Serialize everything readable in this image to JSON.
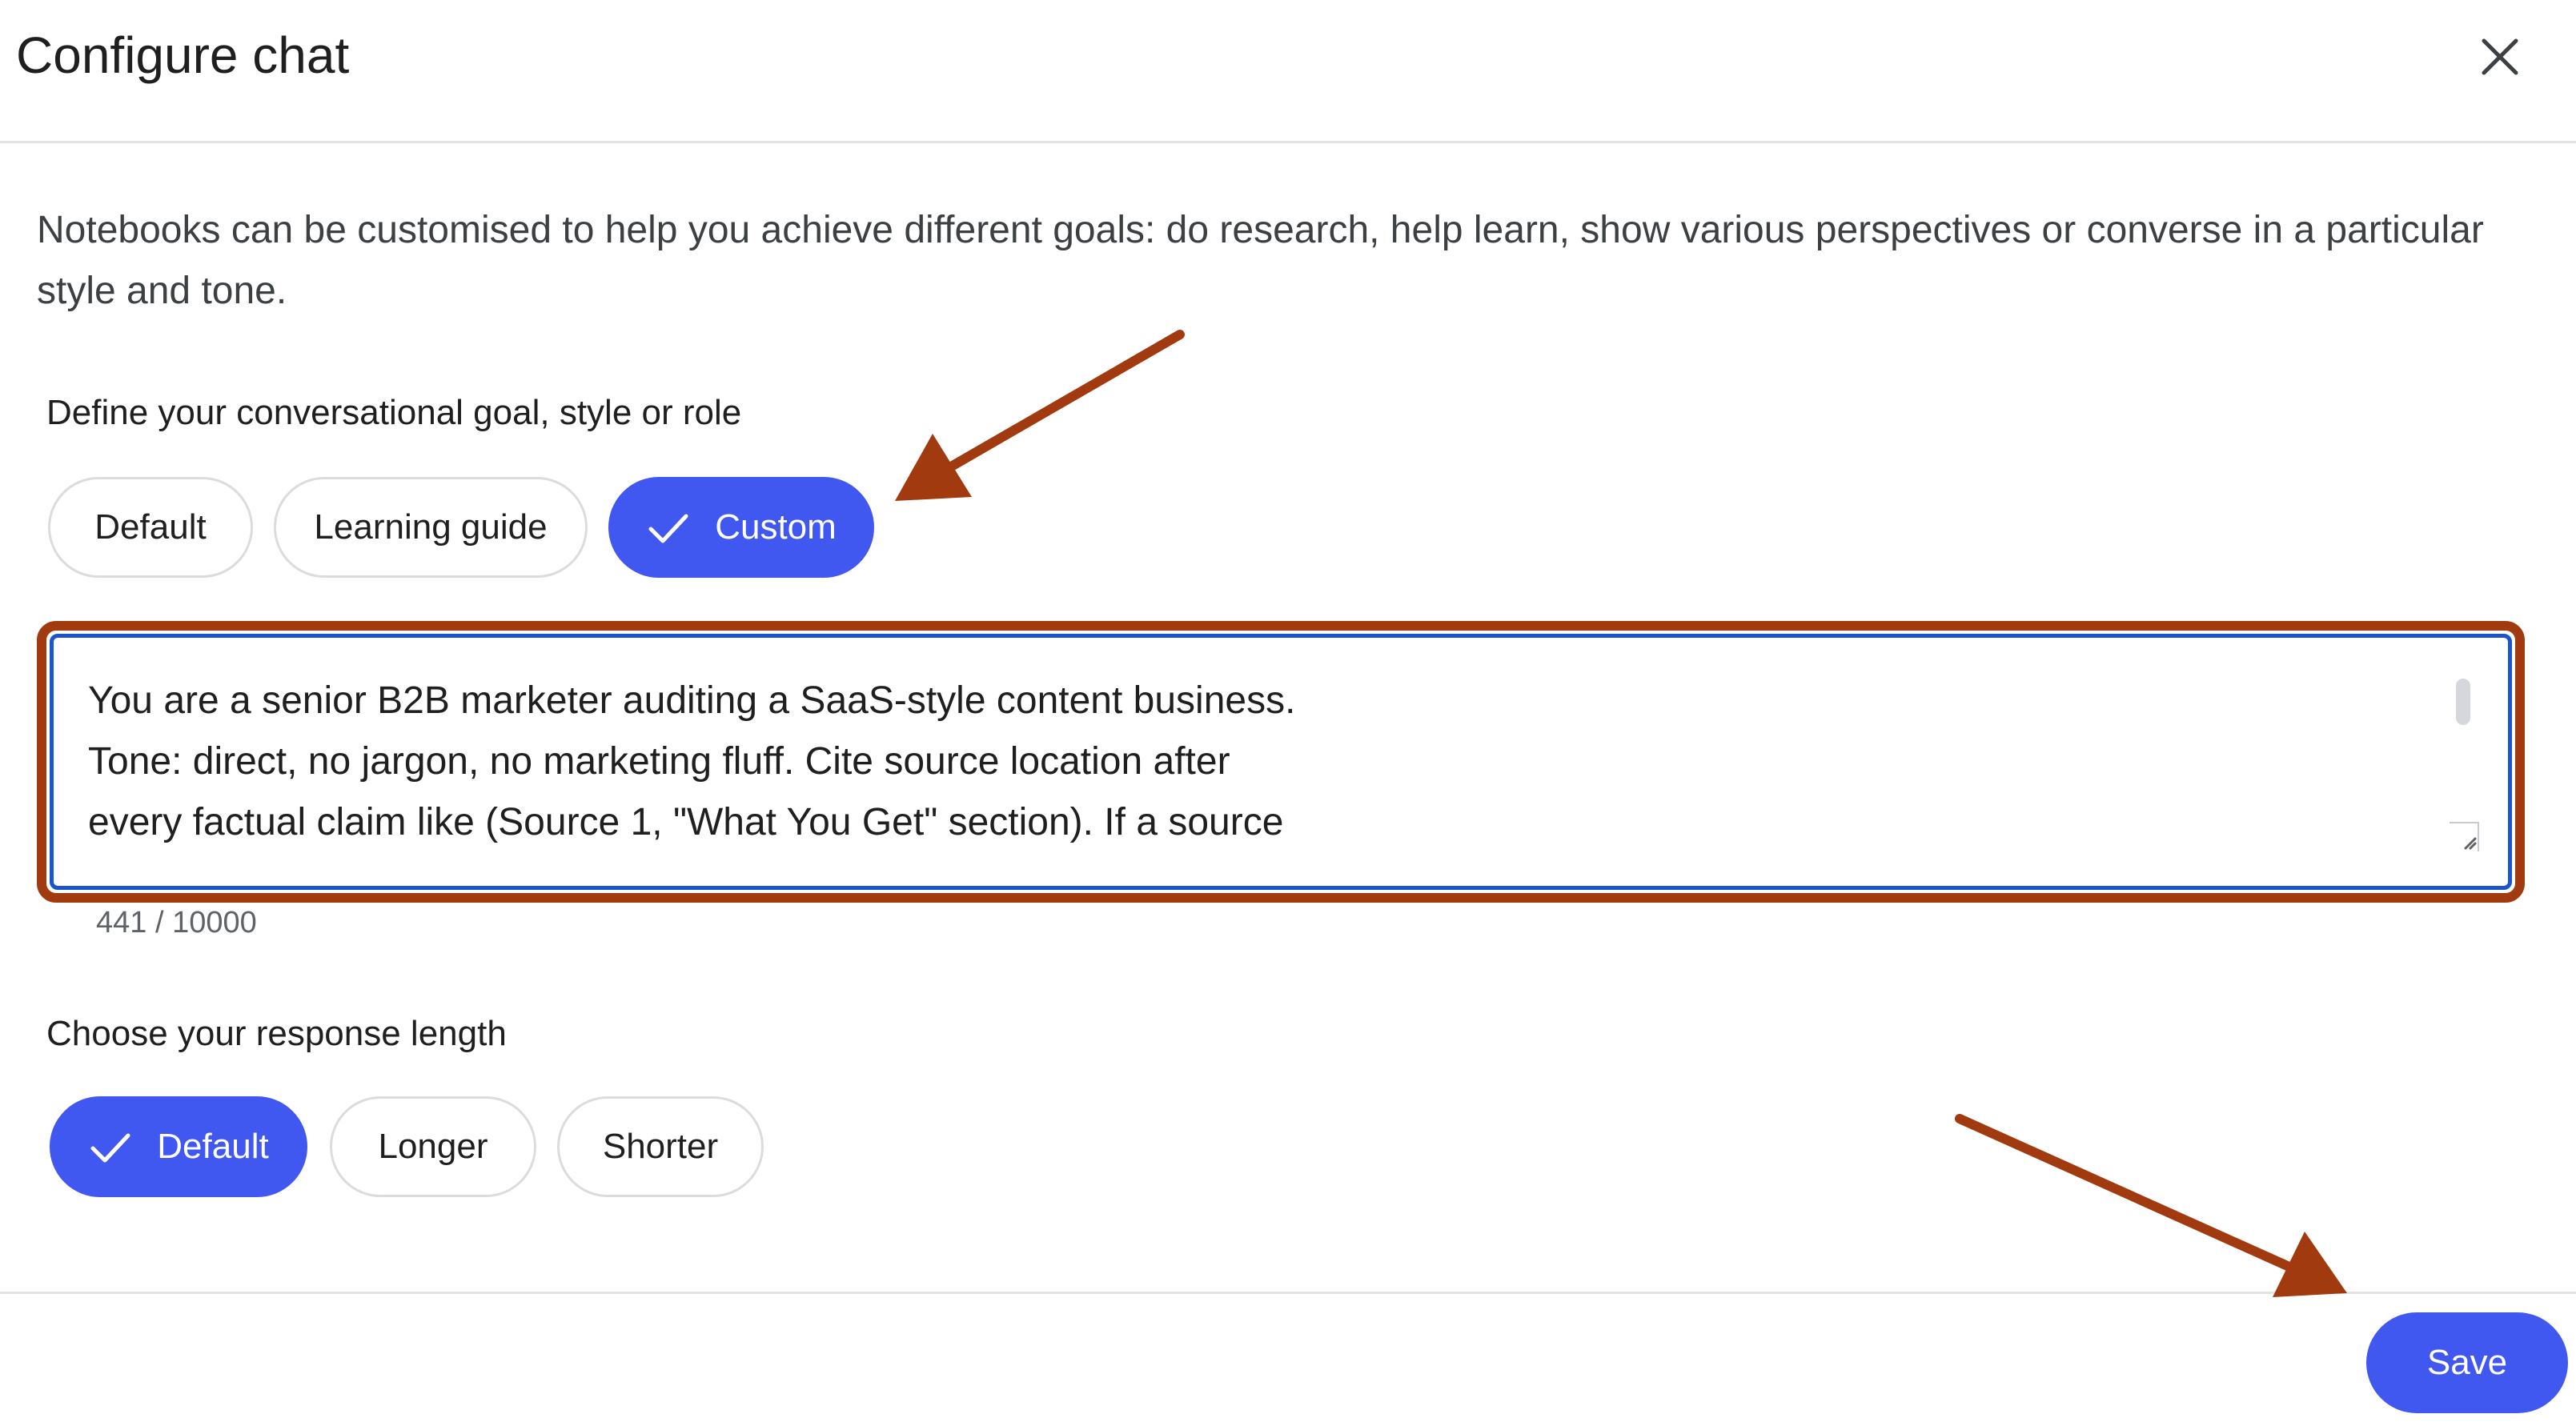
{
  "dialog": {
    "title": "Configure chat"
  },
  "intro_text": "Notebooks can be customised to help you achieve different goals: do research, help learn, show various perspectives or converse in a particular style and tone.",
  "goal_section": {
    "label": "Define your conversational goal, style or role",
    "options": [
      {
        "label": "Default",
        "selected": false
      },
      {
        "label": "Learning guide",
        "selected": false
      },
      {
        "label": "Custom",
        "selected": true
      }
    ]
  },
  "custom_prompt": {
    "visible_text": "You are a senior B2B marketer auditing a SaaS-style content business.\nTone: direct, no jargon, no marketing fluff. Cite source location after\nevery factual claim like (Source 1, \"What You Get\" section). If a source",
    "char_count": "441 / 10000"
  },
  "length_section": {
    "label": "Choose your response length",
    "options": [
      {
        "label": "Default",
        "selected": true
      },
      {
        "label": "Longer",
        "selected": false
      },
      {
        "label": "Shorter",
        "selected": false
      }
    ]
  },
  "footer": {
    "save_label": "Save"
  },
  "colors": {
    "accent": "#4158f0",
    "annotation": "#a23a10",
    "focus_border": "#1a56c9"
  },
  "icons": {
    "close": "close-icon",
    "check": "check-icon",
    "resize": "resize-handle-icon"
  }
}
